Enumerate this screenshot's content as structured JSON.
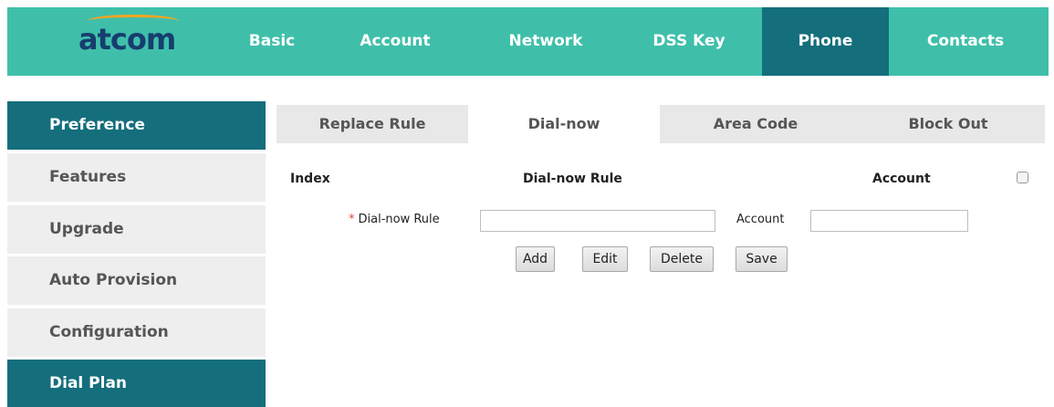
{
  "header": {
    "logo_text": "atcom",
    "nav": [
      {
        "label": "Basic",
        "active": false
      },
      {
        "label": "Account",
        "active": false
      },
      {
        "label": "Network",
        "active": false
      },
      {
        "label": "DSS Key",
        "active": false
      },
      {
        "label": "Phone",
        "active": true
      },
      {
        "label": "Contacts",
        "active": false
      }
    ]
  },
  "sidebar": {
    "items": [
      {
        "label": "Preference",
        "active": true
      },
      {
        "label": "Features",
        "active": false
      },
      {
        "label": "Upgrade",
        "active": false
      },
      {
        "label": "Auto Provision",
        "active": false
      },
      {
        "label": "Configuration",
        "active": false
      },
      {
        "label": "Dial Plan",
        "active": true
      }
    ]
  },
  "tabs": [
    {
      "label": "Replace Rule",
      "active": false
    },
    {
      "label": "Dial-now",
      "active": true
    },
    {
      "label": "Area Code",
      "active": false
    },
    {
      "label": "Block Out",
      "active": false
    }
  ],
  "table": {
    "headers": {
      "index": "Index",
      "rule": "Dial-now Rule",
      "account": "Account"
    },
    "select_all_checked": false
  },
  "form": {
    "required_mark": "*",
    "rule_label": "Dial-now Rule",
    "rule_value": "",
    "account_label": "Account",
    "account_value": ""
  },
  "buttons": {
    "add": "Add",
    "edit": "Edit",
    "delete": "Delete",
    "save": "Save"
  },
  "colors": {
    "header_bg": "#3fbfaa",
    "active_bg": "#146e7c",
    "logo": "#163d6e",
    "logo_accent": "#f5a623",
    "required": "#e0443a"
  }
}
